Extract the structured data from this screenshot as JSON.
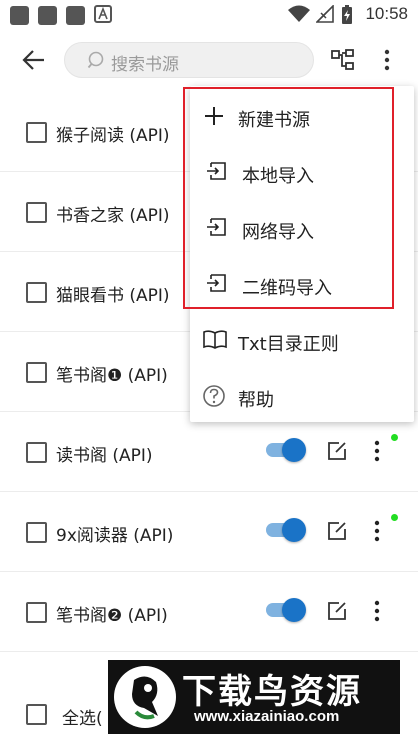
{
  "status_bar": {
    "time": "10:58"
  },
  "toolbar": {
    "search_placeholder": "搜索书源"
  },
  "sources": [
    {
      "name": "猴子阅读 (API)",
      "enabled": true,
      "has_update": false
    },
    {
      "name": "书香之家 (API)",
      "enabled": true,
      "has_update": false
    },
    {
      "name": "猫眼看书 (API)",
      "enabled": true,
      "has_update": false
    },
    {
      "name": "笔书阁❶ (API)",
      "enabled": true,
      "has_update": false
    },
    {
      "name": "读书阁 (API)",
      "enabled": true,
      "has_update": true
    },
    {
      "name": "9x阅读器 (API)",
      "enabled": true,
      "has_update": true
    },
    {
      "name": "笔书阁❷ (API)",
      "enabled": true,
      "has_update": false
    }
  ],
  "bottom_bar": {
    "select_all_label": "全选("
  },
  "menu": {
    "items": [
      {
        "label": "新建书源",
        "icon": "plus-icon"
      },
      {
        "label": "本地导入",
        "icon": "import-icon"
      },
      {
        "label": "网络导入",
        "icon": "import-icon"
      },
      {
        "label": "二维码导入",
        "icon": "import-icon"
      },
      {
        "label": "Txt目录正则",
        "icon": "book-icon"
      },
      {
        "label": "帮助",
        "icon": "help-icon"
      }
    ]
  },
  "watermark": {
    "title": "下载鸟资源",
    "url": "www.xiazainiao.com"
  },
  "colors": {
    "accent": "#1a73c7",
    "switch_track": "#7fb2e0",
    "update_dot": "#22dd22",
    "highlight": "#e0202a"
  }
}
